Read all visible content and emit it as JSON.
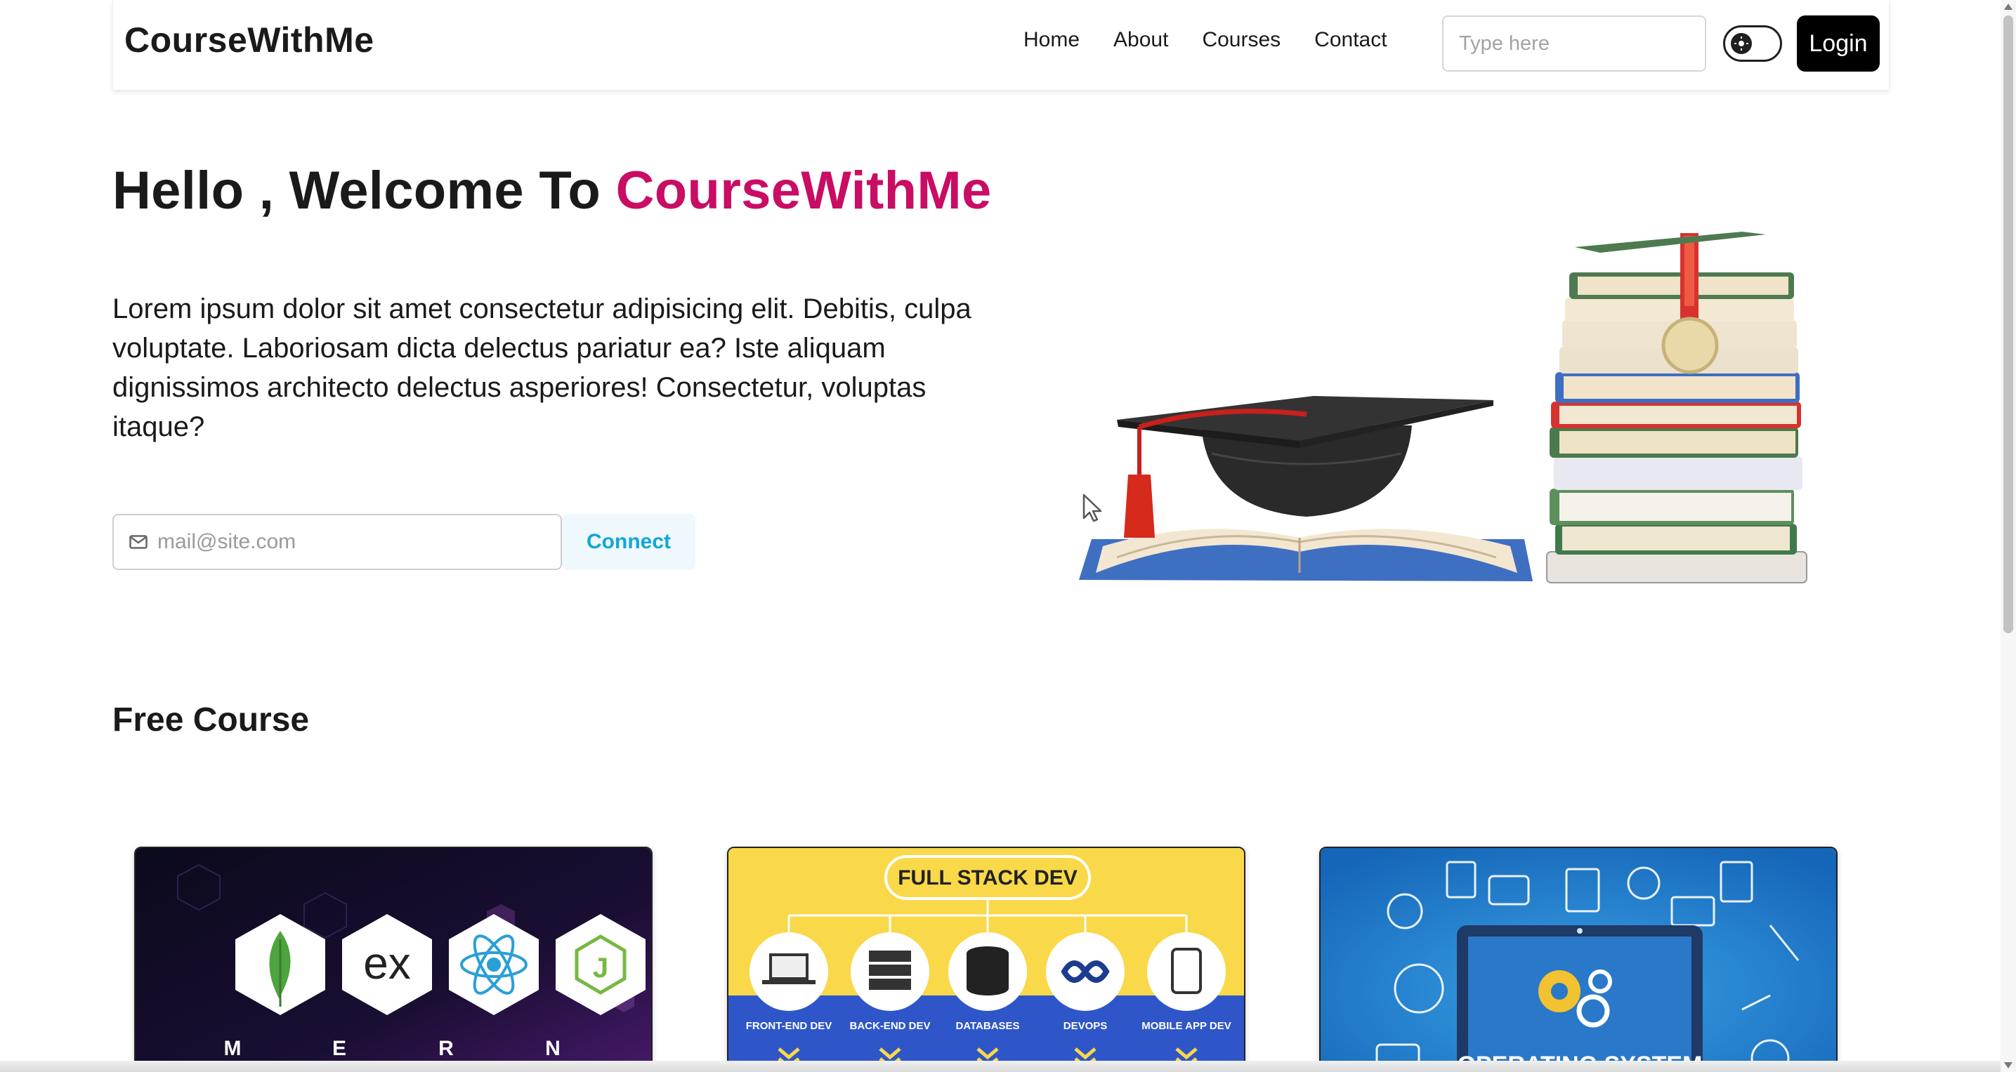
{
  "brand": "CourseWithMe",
  "nav": {
    "links": [
      "Home",
      "About",
      "Courses",
      "Contact"
    ],
    "search_placeholder": "Type here",
    "login_label": "Login"
  },
  "hero": {
    "title_prefix": "Hello , Welcome To ",
    "title_accent": "CourseWithMe",
    "paragraph": "Lorem ipsum dolor sit amet consectetur adipisicing elit. Debitis, culpa voluptate. Laboriosam dicta delectus pariatur ea? Iste aliquam dignissimos architecto delectus asperiores! Consectetur, voluptas itaque?",
    "email_placeholder": "mail@site.com",
    "connect_label": "Connect"
  },
  "free_course": {
    "title": "Free Course",
    "cards": [
      {
        "letters": [
          "M",
          "E",
          "R",
          "N"
        ],
        "ex_text": "ex"
      },
      {
        "banner": "FULL STACK DEV",
        "items": [
          "FRONT-END DEV",
          "BACK-END DEV",
          "DATABASES",
          "DEVOPS",
          "MOBILE APP DEV"
        ]
      },
      {
        "caption": "OPERATING SYSTEM"
      }
    ]
  },
  "colors": {
    "accent": "#c90c64",
    "connect_text": "#12a6d9",
    "login_bg": "#000000"
  }
}
